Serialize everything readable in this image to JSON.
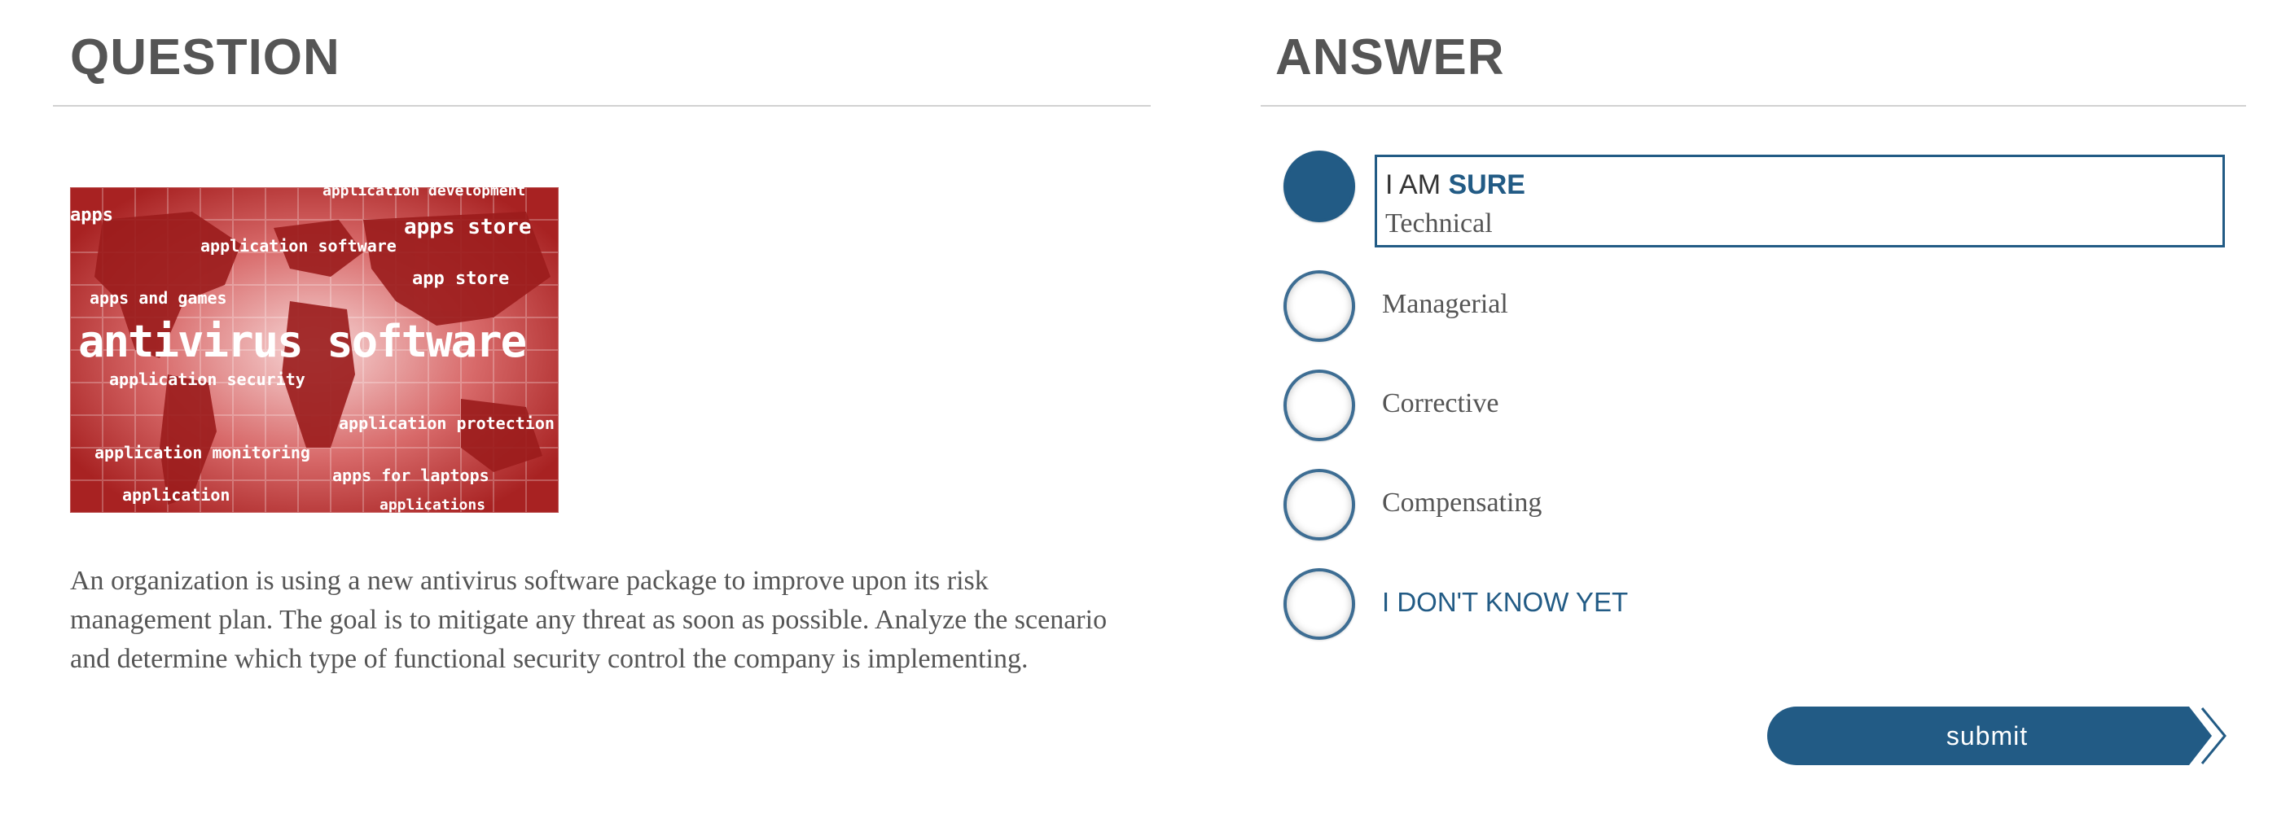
{
  "question": {
    "title": "QUESTION",
    "image": {
      "big_text": "antivirus software",
      "tags": [
        "application development",
        "apps",
        "application software",
        "apps store",
        "app store",
        "apps and games",
        "application security",
        "application protection",
        "application monitoring",
        "apps for laptops",
        "application",
        "applications"
      ]
    },
    "text": "An organization is using a new antivirus software package to improve upon its risk management plan. The goal is to mitigate any threat as soon as possible. Analyze the scenario and determine which type of functional security control the company is implementing."
  },
  "answer": {
    "title": "ANSWER",
    "sure_prefix": "I AM",
    "sure_strong": "SURE",
    "options": [
      {
        "label": "Technical",
        "selected": true
      },
      {
        "label": "Managerial",
        "selected": false
      },
      {
        "label": "Corrective",
        "selected": false
      },
      {
        "label": "Compensating",
        "selected": false
      },
      {
        "label": "I DON'T KNOW YET",
        "selected": false
      }
    ],
    "submit_label": "submit"
  },
  "colors": {
    "accent": "#225b85",
    "heading": "#555555",
    "rule": "#d2d2d2",
    "image_red": "#b22a2a"
  }
}
